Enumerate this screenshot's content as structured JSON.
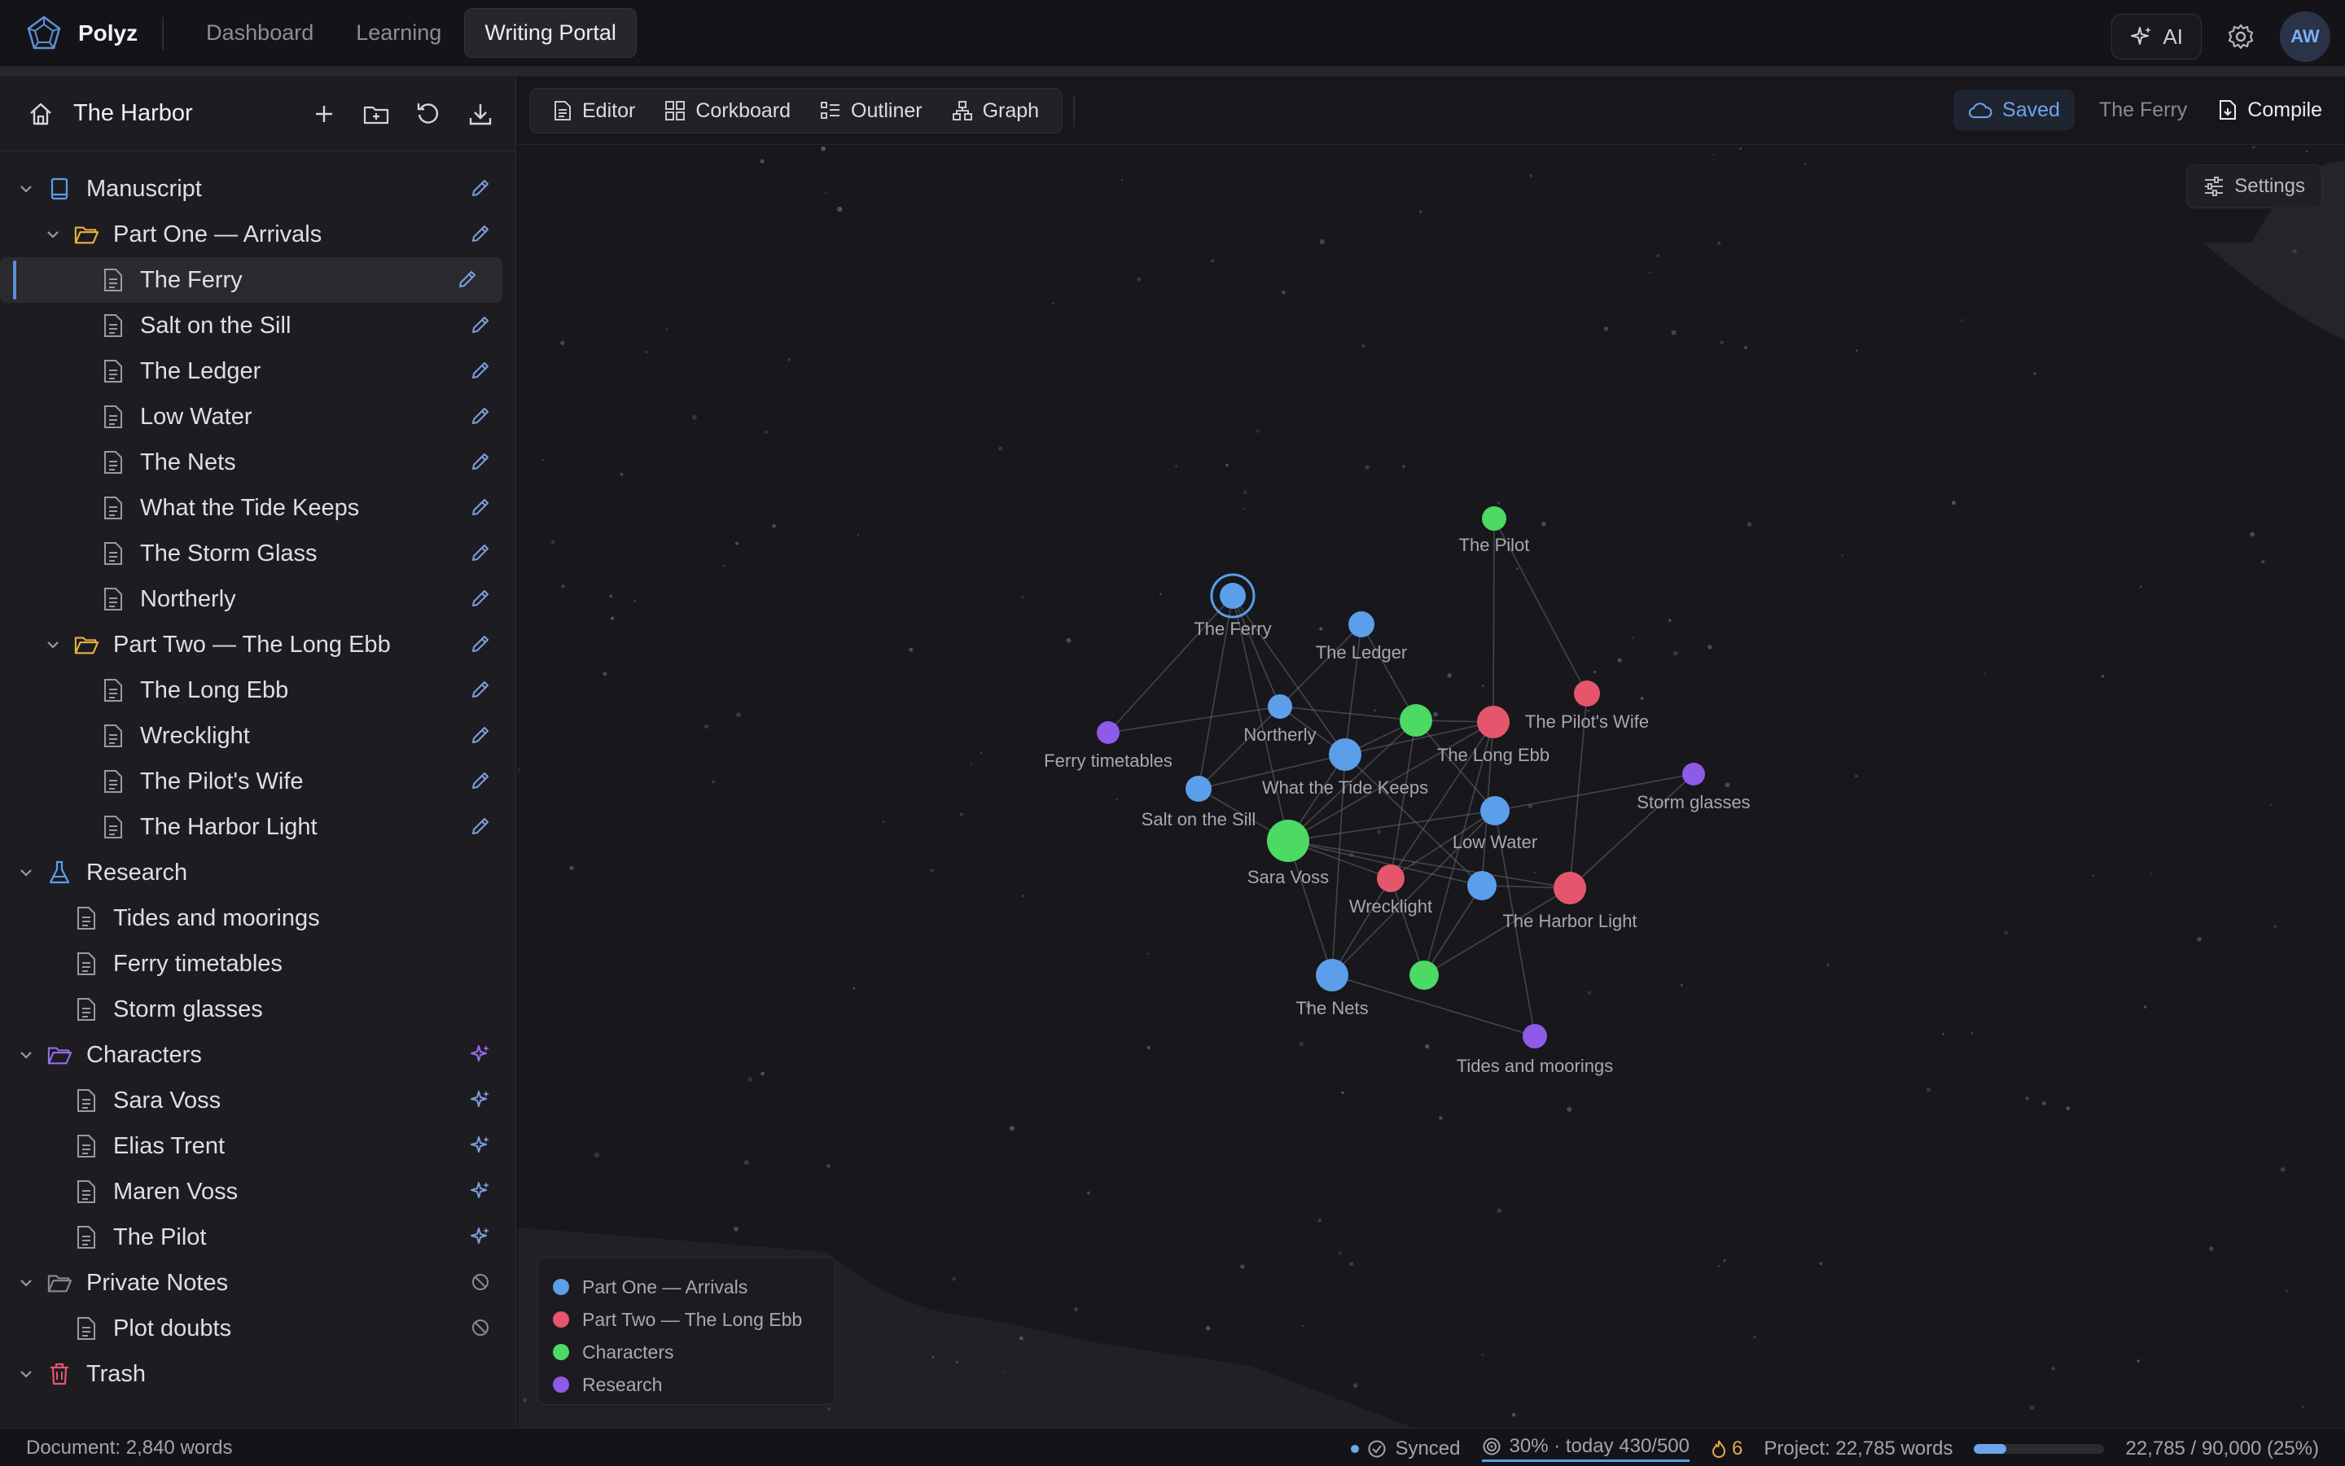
{
  "app": {
    "name": "Polyz",
    "user_initials": "AW",
    "ai_label": "AI"
  },
  "nav": {
    "tabs": [
      {
        "label": "Dashboard"
      },
      {
        "label": "Learning"
      },
      {
        "label": "Writing Portal"
      }
    ]
  },
  "project": {
    "title": "The Harbor"
  },
  "toolbar": {
    "views": [
      {
        "label": "Editor"
      },
      {
        "label": "Corkboard"
      },
      {
        "label": "Outliner"
      },
      {
        "label": "Graph"
      }
    ],
    "saved_label": "Saved",
    "current_doc": "The Ferry",
    "compile_label": "Compile"
  },
  "tree": [
    {
      "label": "Manuscript",
      "level": 0,
      "type": "book",
      "action": "edit"
    },
    {
      "label": "Part One — Arrivals",
      "level": 1,
      "type": "folder-yellow",
      "action": "edit"
    },
    {
      "label": "The Ferry",
      "level": 2,
      "type": "doc",
      "action": "edit",
      "selected": true
    },
    {
      "label": "Salt on the Sill",
      "level": 2,
      "type": "doc",
      "action": "edit"
    },
    {
      "label": "The Ledger",
      "level": 2,
      "type": "doc",
      "action": "edit"
    },
    {
      "label": "Low Water",
      "level": 2,
      "type": "doc",
      "action": "edit"
    },
    {
      "label": "The Nets",
      "level": 2,
      "type": "doc",
      "action": "edit"
    },
    {
      "label": "What the Tide Keeps",
      "level": 2,
      "type": "doc",
      "action": "edit"
    },
    {
      "label": "The Storm Glass",
      "level": 2,
      "type": "doc",
      "action": "edit"
    },
    {
      "label": "Northerly",
      "level": 2,
      "type": "doc",
      "action": "edit"
    },
    {
      "label": "Part Two — The Long Ebb",
      "level": 1,
      "type": "folder-yellow",
      "action": "edit"
    },
    {
      "label": "The Long Ebb",
      "level": 2,
      "type": "doc",
      "action": "edit"
    },
    {
      "label": "Wrecklight",
      "level": 2,
      "type": "doc",
      "action": "edit"
    },
    {
      "label": "The Pilot's Wife",
      "level": 2,
      "type": "doc",
      "action": "edit"
    },
    {
      "label": "The Harbor Light",
      "level": 2,
      "type": "doc",
      "action": "edit"
    },
    {
      "label": "Research",
      "level": 0,
      "type": "flask",
      "action": "none"
    },
    {
      "label": "Tides and moorings",
      "level": 1,
      "type": "doc",
      "action": "none"
    },
    {
      "label": "Ferry timetables",
      "level": 1,
      "type": "doc",
      "action": "none"
    },
    {
      "label": "Storm glasses",
      "level": 1,
      "type": "doc",
      "action": "none"
    },
    {
      "label": "Characters",
      "level": 0,
      "type": "folder-purple",
      "action": "sparkle-active"
    },
    {
      "label": "Sara Voss",
      "level": 1,
      "type": "doc",
      "action": "sparkle"
    },
    {
      "label": "Elias Trent",
      "level": 1,
      "type": "doc",
      "action": "sparkle"
    },
    {
      "label": "Maren Voss",
      "level": 1,
      "type": "doc",
      "action": "sparkle"
    },
    {
      "label": "The Pilot",
      "level": 1,
      "type": "doc",
      "action": "sparkle"
    },
    {
      "label": "Private Notes",
      "level": 0,
      "type": "folder-grey",
      "action": "blocked"
    },
    {
      "label": "Plot doubts",
      "level": 1,
      "type": "doc",
      "action": "blocked"
    },
    {
      "label": "Trash",
      "level": 0,
      "type": "trash",
      "action": "none"
    }
  ],
  "graph": {
    "settings_label": "Settings",
    "colors": {
      "part1": "#5b9ee9",
      "part2": "#e5566d",
      "characters": "#4cd964",
      "research": "#8e5ae8"
    },
    "legend": [
      {
        "label": "Part One — Arrivals",
        "group": "part1"
      },
      {
        "label": "Part Two — The Long Ebb",
        "group": "part2"
      },
      {
        "label": "Characters",
        "group": "characters"
      },
      {
        "label": "Research",
        "group": "research"
      }
    ],
    "nodes": [
      {
        "id": "ferry",
        "label": "The Ferry",
        "group": "part1",
        "focused": true
      },
      {
        "id": "ledger",
        "label": "The Ledger",
        "group": "part1"
      },
      {
        "id": "pilot",
        "label": "The Pilot",
        "group": "characters"
      },
      {
        "id": "pilotswife",
        "label": "The Pilot's Wife",
        "group": "part2"
      },
      {
        "id": "northerly",
        "label": "Northerly",
        "group": "part1"
      },
      {
        "id": "ferrytt",
        "label": "Ferry timetables",
        "group": "research"
      },
      {
        "id": "salt",
        "label": "Salt on the Sill",
        "group": "part1"
      },
      {
        "id": "tide",
        "label": "What the Tide Keeps",
        "group": "part1"
      },
      {
        "id": "char1",
        "label": "",
        "group": "characters"
      },
      {
        "id": "longebb",
        "label": "The Long Ebb",
        "group": "part2"
      },
      {
        "id": "stormg",
        "label": "Storm glasses",
        "group": "research"
      },
      {
        "id": "lowwater",
        "label": "Low Water",
        "group": "part1"
      },
      {
        "id": "sara",
        "label": "Sara Voss",
        "group": "characters"
      },
      {
        "id": "wreck",
        "label": "Wrecklight",
        "group": "part2"
      },
      {
        "id": "stormglass",
        "label": "",
        "group": "part1"
      },
      {
        "id": "harborlight",
        "label": "The Harbor Light",
        "group": "part2"
      },
      {
        "id": "nets",
        "label": "The Nets",
        "group": "part1"
      },
      {
        "id": "char2",
        "label": "",
        "group": "characters"
      },
      {
        "id": "tides",
        "label": "Tides and moorings",
        "group": "research"
      }
    ]
  },
  "status": {
    "document": "Document: 2,840 words",
    "synced": "Synced",
    "goal": "30% · today 430/500",
    "streak": "6",
    "project": "Project: 22,785 words",
    "project_progress": 0.25,
    "project_total": "22,785 / 90,000 (25%)"
  }
}
